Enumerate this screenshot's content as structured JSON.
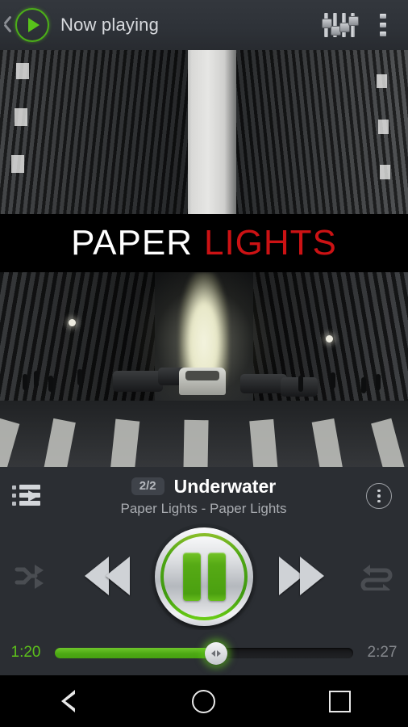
{
  "header": {
    "back_icon": "chevron-left-icon",
    "app_logo_icon": "play-circle-logo",
    "title": "Now playing",
    "equalizer_icon": "equalizer-icon",
    "overflow_icon": "more-vertical-icon",
    "accent_green": "#58c21a"
  },
  "album_art": {
    "banner_word_1": "PAPER",
    "banner_word_2": "LIGHTS",
    "banner_color_1": "#ffffff",
    "banner_color_2": "#cc1214",
    "description": "black and white city street with glowing light between buildings"
  },
  "track": {
    "queue_icon": "playlist-queue-icon",
    "position_badge": "2/2",
    "title": "Underwater",
    "subtitle": "Paper Lights - Paper Lights",
    "overflow_icon": "more-options-circle-icon"
  },
  "controls": {
    "shuffle_icon": "shuffle-icon",
    "shuffle_state": "off",
    "previous_icon": "rewind-icon",
    "play_pause_icon": "pause-icon",
    "play_pause_state": "playing",
    "next_icon": "fast-forward-icon",
    "repeat_icon": "repeat-icon",
    "repeat_state": "off",
    "inactive_color": "#4a4d52",
    "active_color": "#4da914"
  },
  "seek": {
    "current_time": "1:20",
    "total_time": "2:27",
    "progress_percent": 54,
    "thumb_icon": "seek-thumb-arrows",
    "elapsed_color": "#5cc01b",
    "remaining_color": "#85888d"
  },
  "navbar": {
    "back_icon": "android-back-icon",
    "home_icon": "android-home-icon",
    "recents_icon": "android-recents-icon"
  }
}
